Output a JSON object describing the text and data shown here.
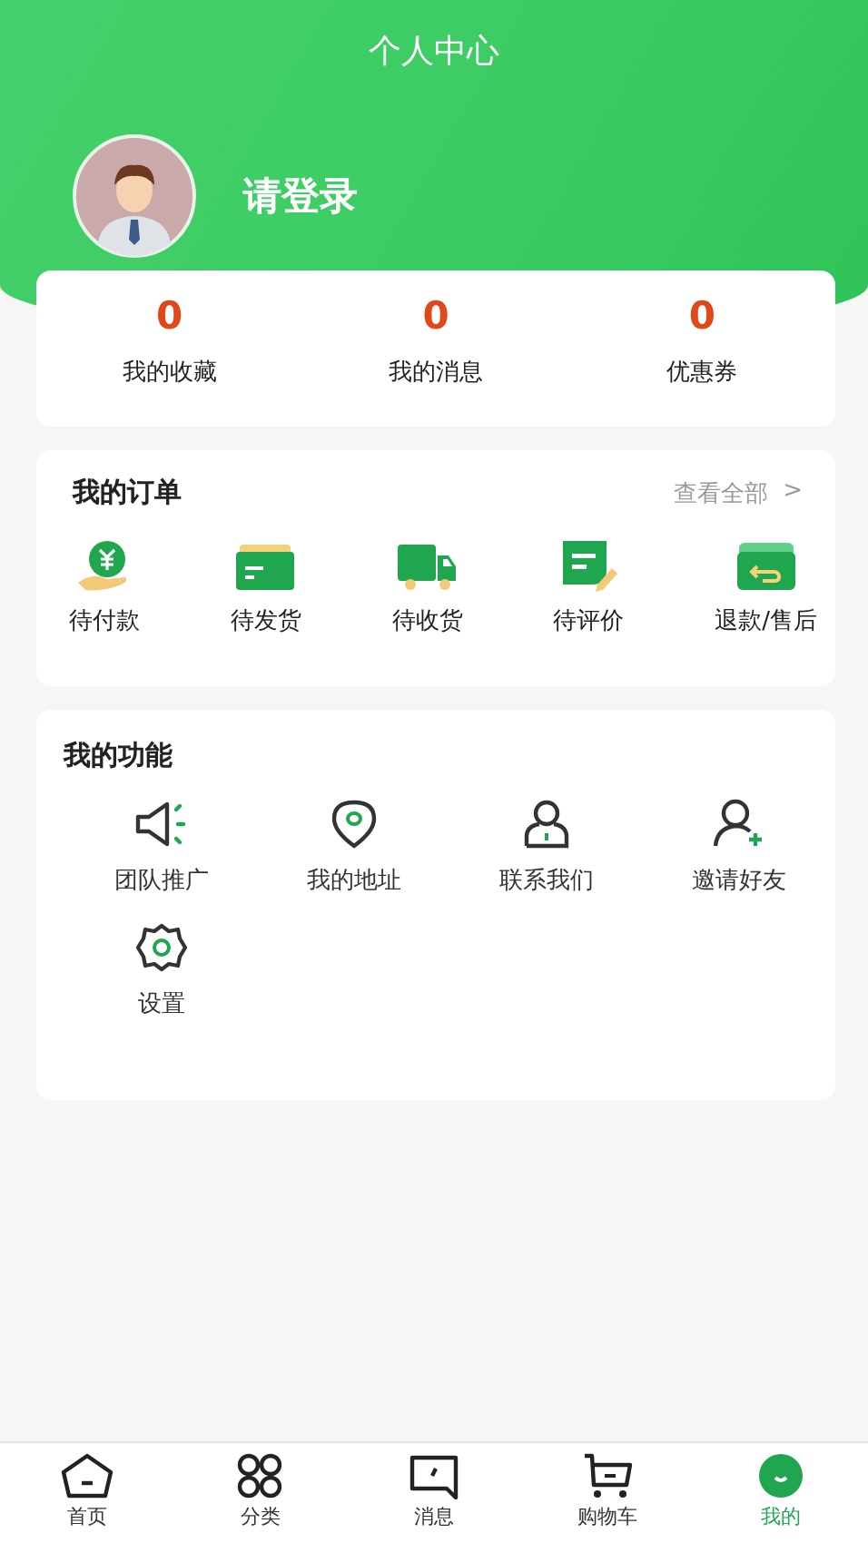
{
  "header": {
    "title": "个人中心"
  },
  "profile": {
    "name": "请登录"
  },
  "stats": [
    {
      "value": "0",
      "label": "我的收藏"
    },
    {
      "value": "0",
      "label": "我的消息"
    },
    {
      "value": "0",
      "label": "优惠券"
    }
  ],
  "orders": {
    "title": "我的订单",
    "view_all": "查看全部",
    "view_all_arrow": ">",
    "items": [
      {
        "kind": "pay",
        "label": "待付款"
      },
      {
        "kind": "ship",
        "label": "待发货"
      },
      {
        "kind": "truck",
        "label": "待收货"
      },
      {
        "kind": "review",
        "label": "待评价"
      },
      {
        "kind": "refund",
        "label": "退款/售后"
      }
    ]
  },
  "functions": {
    "title": "我的功能",
    "items": [
      {
        "kind": "megaphone",
        "label": "团队推广"
      },
      {
        "kind": "pin",
        "label": "我的地址"
      },
      {
        "kind": "person",
        "label": "联系我们"
      },
      {
        "kind": "add-person",
        "label": "邀请好友"
      },
      {
        "kind": "gear",
        "label": "设置"
      }
    ]
  },
  "tabs": [
    {
      "kind": "home",
      "label": "首页",
      "selected": false
    },
    {
      "kind": "grid",
      "label": "分类",
      "selected": false
    },
    {
      "kind": "message",
      "label": "消息",
      "selected": false
    },
    {
      "kind": "cart",
      "label": "购物车",
      "selected": false
    },
    {
      "kind": "me",
      "label": "我的",
      "selected": true
    }
  ]
}
